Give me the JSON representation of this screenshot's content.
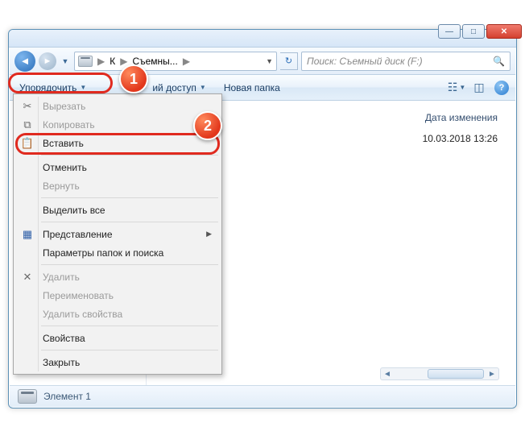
{
  "window": {
    "sys": {
      "min": "—",
      "max": "□",
      "close": "✕"
    }
  },
  "nav": {
    "crumb1": "К",
    "crumb2": "Съемны...",
    "sep": "▶",
    "refresh": "↻"
  },
  "search": {
    "placeholder": "Поиск: Съемный диск (F:)"
  },
  "toolbar": {
    "organize": "Упорядочить",
    "share": "ий доступ",
    "newfolder": "Новая папка"
  },
  "menu": {
    "cut": "Вырезать",
    "copy": "Копировать",
    "paste": "Вставить",
    "undo": "Отменить",
    "redo": "Вернуть",
    "selectall": "Выделить все",
    "view": "Представление",
    "folderopts": "Параметры папок и поиска",
    "delete": "Удалить",
    "rename": "Переименовать",
    "removeprops": "Удалить свойства",
    "props": "Свойства",
    "close": "Закрыть"
  },
  "files": {
    "col_date": "Дата изменения",
    "row_date": "10.03.2018 13:26"
  },
  "status": {
    "text": "Элемент 1"
  },
  "badges": {
    "one": "1",
    "two": "2"
  }
}
